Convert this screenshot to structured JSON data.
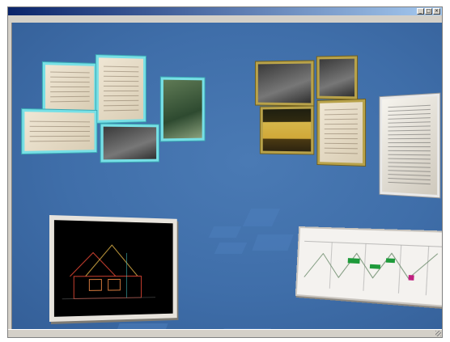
{
  "window": {
    "title": "",
    "buttons": {
      "minimize": "_",
      "maximize": "□",
      "close": "×"
    }
  },
  "menubar": {
    "items": [
      "",
      "",
      "",
      "",
      ""
    ]
  },
  "viewport": {
    "cad_panel": {
      "title": ""
    },
    "sheet_panel": {
      "title": ""
    }
  },
  "statusbar": {
    "text": ""
  },
  "colors": {
    "viewport_blue": "#3f6ea9",
    "frame_cyan": "#77e0e6",
    "frame_gold": "#b8a24a"
  }
}
